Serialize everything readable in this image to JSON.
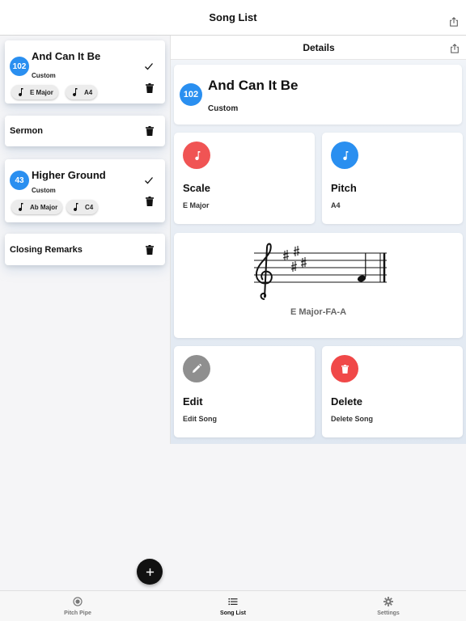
{
  "nav": {
    "title": "Song List"
  },
  "songs": [
    {
      "number": "102",
      "title": "And Can It Be",
      "type": "Custom",
      "scale": "E Major",
      "pitch": "A4"
    },
    {
      "title": "Sermon"
    },
    {
      "number": "43",
      "title": "Higher Ground",
      "type": "Custom",
      "scale": "Ab Major",
      "pitch": "C4"
    },
    {
      "title": "Closing Remarks"
    }
  ],
  "details": {
    "header": "Details",
    "number": "102",
    "title": "And Can It Be",
    "type": "Custom",
    "scale": {
      "label": "Scale",
      "value": "E Major"
    },
    "pitch": {
      "label": "Pitch",
      "value": "A4"
    },
    "staff_caption": "E Major-FA-A",
    "edit": {
      "label": "Edit",
      "sub": "Edit Song"
    },
    "delete": {
      "label": "Delete",
      "sub": "Delete Song"
    }
  },
  "tabs": [
    {
      "label": "Pitch Pipe",
      "icon": "record-icon"
    },
    {
      "label": "Song List",
      "icon": "list-icon",
      "active": true
    },
    {
      "label": "Settings",
      "icon": "gear-icon"
    }
  ],
  "colors": {
    "accent_blue": "#2a8ff0",
    "scale_red": "#f05454",
    "delete_red": "#f04848",
    "edit_gray": "#8f8f8f"
  }
}
